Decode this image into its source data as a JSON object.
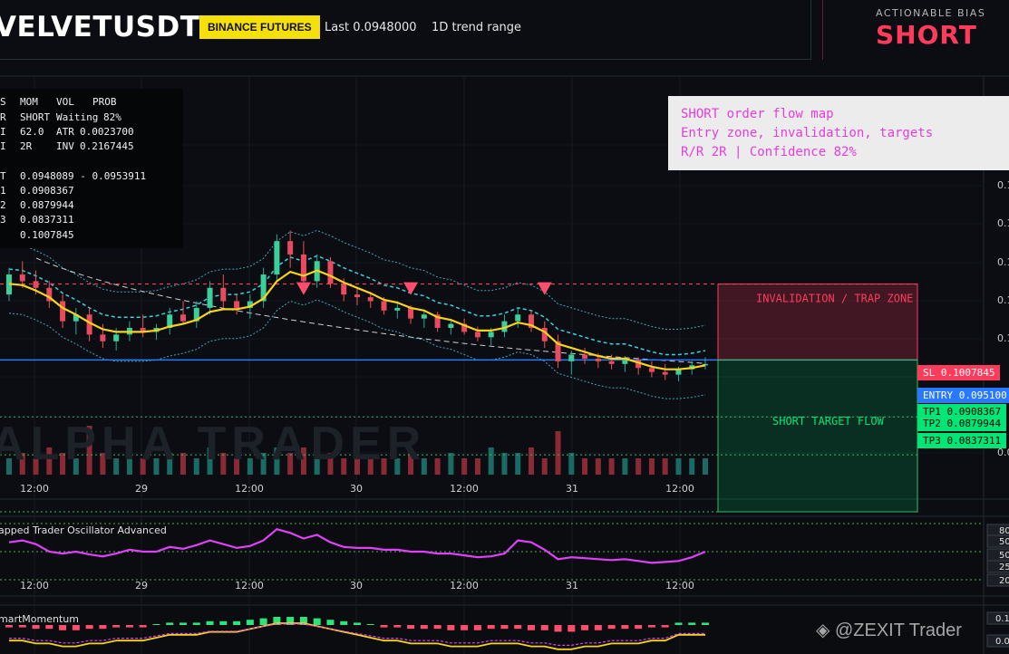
{
  "header": {
    "symbol": "VELVETUSDT",
    "exchange": "BINANCE FUTURES",
    "last": "Last 0.0948000",
    "range": "1D trend range"
  },
  "bias": {
    "label": "ACTIONABLE BIAS",
    "value": "SHORT"
  },
  "stats_panel": {
    "header": [
      "S",
      "MOM",
      "VOL",
      "PROB"
    ],
    "rows": [
      [
        "R",
        "SHORT",
        "Waiting",
        "82%"
      ],
      [
        "I",
        "62.0",
        "ATR",
        "0.0023700"
      ],
      [
        "I",
        "2R",
        "INV",
        "0.2167445"
      ],
      [
        "T",
        "0.0948089 - 0.0953911",
        "",
        ""
      ],
      [
        "1",
        "0.0908367",
        "",
        ""
      ],
      [
        "2",
        "0.0879944",
        "",
        ""
      ],
      [
        "3",
        "0.0837311",
        "",
        ""
      ],
      [
        "",
        "0.1007845",
        "",
        ""
      ]
    ]
  },
  "annotation": {
    "line1": "SHORT order flow map",
    "line2": "Entry zone, invalidation, targets",
    "line3": "R/R 2R | Confidence 82%"
  },
  "zones": {
    "invalidation": "INVALIDATION / TRAP ZONE",
    "target": "SHORT TARGET FLOW"
  },
  "price_labels": {
    "sl": "SL 0.1007845",
    "entry": "ENTRY 0.095100",
    "tp1": "TP1 0.0908367",
    "tp2": "TP2 0.0879944",
    "tp3": "TP3 0.0837311"
  },
  "time_axis": [
    "12:00",
    "29",
    "12:00",
    "30",
    "12:00",
    "31",
    "12:00"
  ],
  "right_axis_ticks": [
    "0.",
    "0.1",
    "0.1",
    "0.1",
    "0.1",
    "0.1",
    "0.0"
  ],
  "oscillator": {
    "title": "apped Trader Oscillator Advanced",
    "levels": [
      "80",
      "50",
      "50",
      "25",
      "20"
    ]
  },
  "momentum": {
    "title": "martMomentum",
    "levels": [
      "0.1",
      "0.0"
    ]
  },
  "watermarks": {
    "center": "ALPHA TRADER",
    "brand": "@ZEXIT Trader"
  },
  "colors": {
    "up": "#26a69a",
    "down": "#ef5350",
    "ema": "#f7d417",
    "entry": "#2979ff",
    "sl": "#ff3b5c",
    "tp": "#00e676",
    "osc": "#e040fb"
  },
  "chart_data": {
    "type": "candlestick",
    "x": [
      "28 12:00",
      "29",
      "29 12:00",
      "30",
      "30 12:00",
      "31",
      "31 12:00"
    ],
    "candles": [
      [
        0.1,
        0.102,
        0.0995,
        0.1015
      ],
      [
        0.1015,
        0.1025,
        0.1005,
        0.101
      ],
      [
        0.101,
        0.1018,
        0.1,
        0.1005
      ],
      [
        0.1005,
        0.101,
        0.099,
        0.0995
      ],
      [
        0.0995,
        0.1,
        0.0975,
        0.098
      ],
      [
        0.098,
        0.099,
        0.097,
        0.0985
      ],
      [
        0.0985,
        0.099,
        0.0965,
        0.097
      ],
      [
        0.097,
        0.0978,
        0.096,
        0.0965
      ],
      [
        0.0965,
        0.0975,
        0.0958,
        0.097
      ],
      [
        0.097,
        0.098,
        0.0965,
        0.0975
      ],
      [
        0.0975,
        0.0985,
        0.0968,
        0.0972
      ],
      [
        0.0972,
        0.0978,
        0.0966,
        0.0975
      ],
      [
        0.0975,
        0.099,
        0.097,
        0.0985
      ],
      [
        0.0985,
        0.0995,
        0.0978,
        0.098
      ],
      [
        0.098,
        0.0995,
        0.0975,
        0.099
      ],
      [
        0.099,
        0.101,
        0.0985,
        0.1005
      ],
      [
        0.1005,
        0.1015,
        0.099,
        0.0995
      ],
      [
        0.0995,
        0.1,
        0.0985,
        0.099
      ],
      [
        0.099,
        0.1,
        0.0982,
        0.0995
      ],
      [
        0.0995,
        0.102,
        0.099,
        0.1015
      ],
      [
        0.1015,
        0.1045,
        0.101,
        0.104
      ],
      [
        0.104,
        0.1048,
        0.102,
        0.103
      ],
      [
        0.103,
        0.104,
        0.1005,
        0.101
      ],
      [
        0.101,
        0.103,
        0.1005,
        0.1025
      ],
      [
        0.1025,
        0.1028,
        0.1005,
        0.1008
      ],
      [
        0.1008,
        0.1012,
        0.0995,
        0.1
      ],
      [
        0.1,
        0.1005,
        0.0992,
        0.0998
      ],
      [
        0.0998,
        0.1002,
        0.099,
        0.0995
      ],
      [
        0.0995,
        0.0998,
        0.0985,
        0.0988
      ],
      [
        0.0988,
        0.0995,
        0.0982,
        0.099
      ],
      [
        0.099,
        0.0992,
        0.0978,
        0.0982
      ],
      [
        0.0982,
        0.0988,
        0.0975,
        0.0985
      ],
      [
        0.0985,
        0.0987,
        0.0972,
        0.0975
      ],
      [
        0.0975,
        0.098,
        0.097,
        0.0978
      ],
      [
        0.0978,
        0.0982,
        0.097,
        0.0972
      ],
      [
        0.0972,
        0.0976,
        0.0965,
        0.0968
      ],
      [
        0.0968,
        0.0975,
        0.0962,
        0.0972
      ],
      [
        0.0972,
        0.0985,
        0.0968,
        0.098
      ],
      [
        0.098,
        0.099,
        0.0975,
        0.0985
      ],
      [
        0.0985,
        0.0988,
        0.0972,
        0.0975
      ],
      [
        0.0975,
        0.098,
        0.096,
        0.0965
      ],
      [
        0.0965,
        0.097,
        0.0945,
        0.095
      ],
      [
        0.095,
        0.0958,
        0.094,
        0.0955
      ],
      [
        0.0955,
        0.096,
        0.0948,
        0.0952
      ],
      [
        0.0952,
        0.0956,
        0.0945,
        0.095
      ],
      [
        0.095,
        0.0955,
        0.0944,
        0.0948
      ],
      [
        0.0948,
        0.0954,
        0.0942,
        0.0951
      ],
      [
        0.0951,
        0.0953,
        0.094,
        0.0945
      ],
      [
        0.0945,
        0.095,
        0.0938,
        0.0942
      ],
      [
        0.0942,
        0.0948,
        0.0936,
        0.094
      ],
      [
        0.094,
        0.0946,
        0.0935,
        0.0944
      ],
      [
        0.0944,
        0.095,
        0.094,
        0.0947
      ],
      [
        0.0947,
        0.0953,
        0.0944,
        0.0948
      ]
    ],
    "volume": [
      3,
      4,
      3,
      5,
      4,
      3,
      9,
      4,
      3,
      4,
      3,
      3,
      4,
      4,
      3,
      5,
      4,
      3,
      3,
      4,
      5,
      4,
      5,
      3,
      4,
      3,
      3,
      3,
      3,
      3,
      4,
      3,
      3,
      4,
      3,
      3,
      5,
      4,
      4,
      5,
      3,
      8,
      4,
      3,
      3,
      3,
      3,
      3,
      3,
      3,
      3,
      3,
      3
    ],
    "ema": [
      0.1008,
      0.1007,
      0.1003,
      0.0998,
      0.099,
      0.0985,
      0.0979,
      0.0974,
      0.0972,
      0.0972,
      0.0972,
      0.0973,
      0.0976,
      0.0978,
      0.0981,
      0.0987,
      0.0989,
      0.0989,
      0.0991,
      0.0997,
      0.101,
      0.1017,
      0.1014,
      0.1018,
      0.1014,
      0.1009,
      0.1005,
      0.1001,
      0.0996,
      0.0994,
      0.099,
      0.0988,
      0.0983,
      0.0981,
      0.0977,
      0.0973,
      0.0973,
      0.0975,
      0.0979,
      0.0977,
      0.0972,
      0.0963,
      0.096,
      0.0957,
      0.0954,
      0.0952,
      0.0952,
      0.0949,
      0.0946,
      0.0944,
      0.0944,
      0.0945,
      0.0947
    ],
    "oscillator": [
      60,
      62,
      58,
      50,
      48,
      50,
      47,
      45,
      48,
      52,
      50,
      50,
      55,
      53,
      57,
      62,
      58,
      54,
      56,
      62,
      74,
      70,
      64,
      68,
      60,
      55,
      54,
      54,
      52,
      52,
      50,
      50,
      48,
      48,
      46,
      44,
      45,
      48,
      62,
      60,
      52,
      42,
      44,
      43,
      42,
      41,
      42,
      40,
      38,
      39,
      40,
      44,
      50
    ],
    "momentum_hist": [
      -1,
      -1,
      -2,
      -2,
      -3,
      -3,
      -2,
      -2,
      -1,
      -1,
      -1,
      0,
      1,
      1,
      1,
      2,
      2,
      2,
      3,
      4,
      5,
      5,
      5,
      4,
      3,
      2,
      1,
      0,
      -1,
      -1,
      -2,
      -2,
      -2,
      -3,
      -3,
      -3,
      -2,
      -2,
      -2,
      -3,
      -3,
      -4,
      -4,
      -3,
      -3,
      -2,
      -2,
      -2,
      -1,
      -1,
      1,
      1,
      1
    ],
    "levels": {
      "sl": 0.1007845,
      "entry": 0.0951,
      "tp1": 0.0908367,
      "tp2": 0.0879944,
      "tp3": 0.0837311
    },
    "ylim": [
      0.08,
      0.115
    ],
    "short_signals_at": [
      22,
      30,
      40
    ]
  }
}
